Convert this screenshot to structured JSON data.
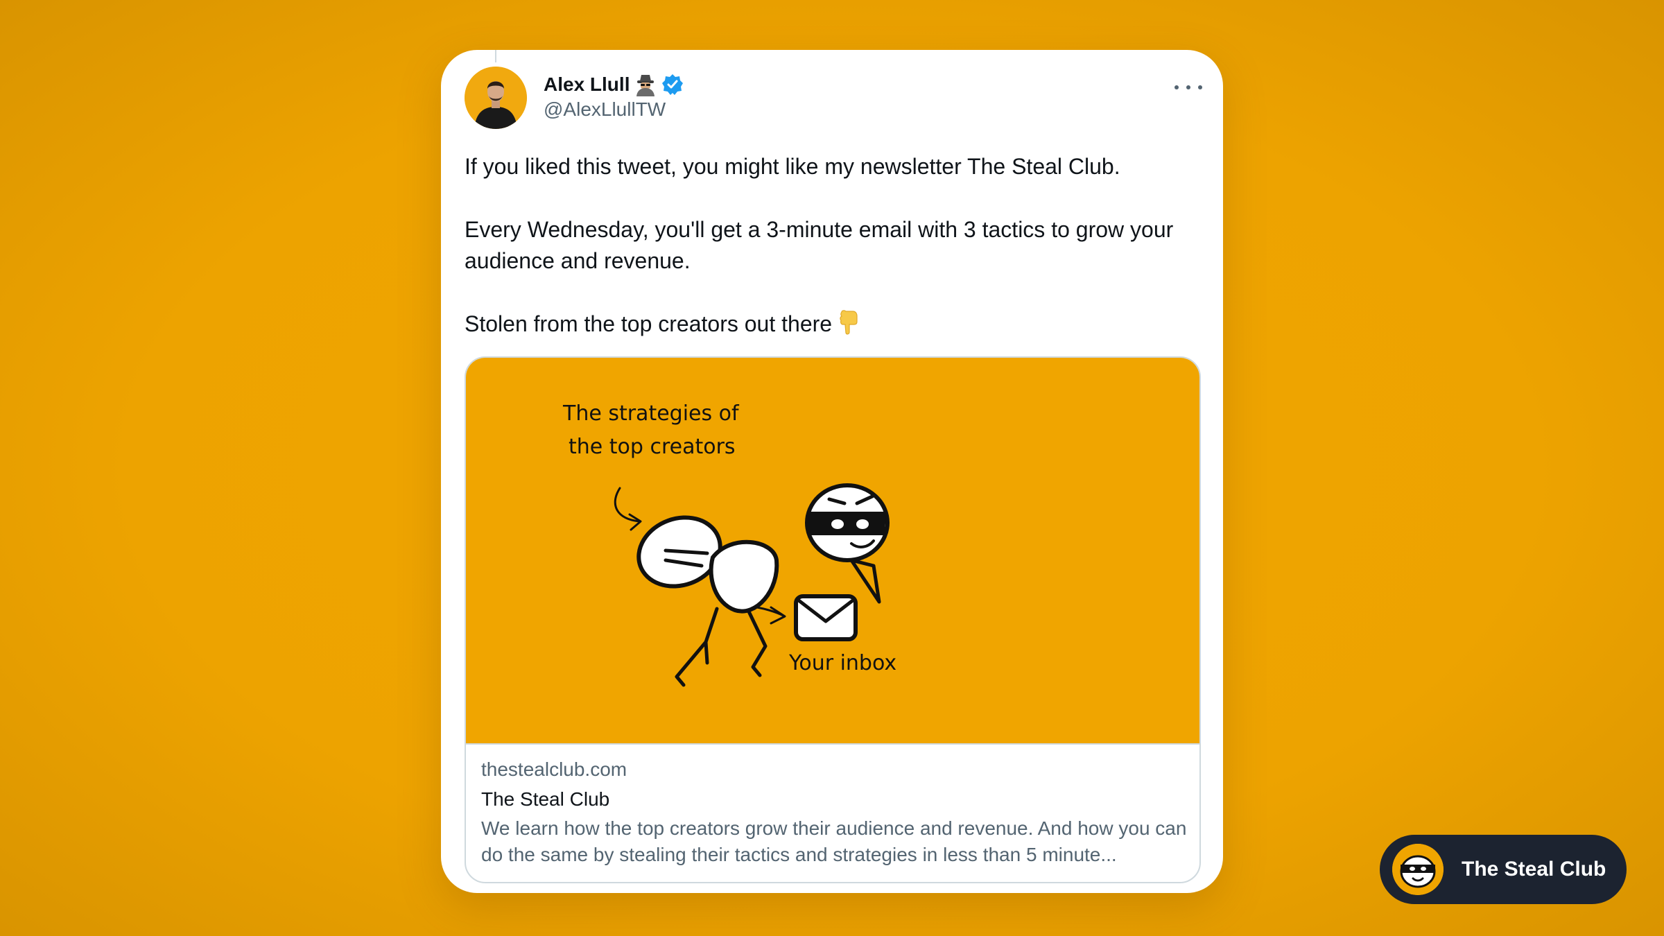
{
  "tweet": {
    "author_name": "Alex Llull",
    "author_handle": "@AlexLlullTW",
    "paragraphs": [
      "If you liked this tweet, you might like my newsletter The Steal Club.",
      "Every Wednesday, you'll get a 3-minute email with 3 tactics to grow your audience and revenue.",
      "Stolen from the top creators out there"
    ]
  },
  "link_card": {
    "image_caption_top": [
      "The strategies of",
      "the top creators"
    ],
    "image_caption_bottom": "Your inbox",
    "domain": "thestealclub.com",
    "title": "The Steal Club",
    "description": "We learn how the top creators grow their audience and revenue. And how you can do the same by stealing their tactics and strategies in less than 5 minute..."
  },
  "badge": {
    "label": "The Steal Club"
  },
  "colors": {
    "background": "#f0a500",
    "card": "#ffffff",
    "verified": "#1d9bf0",
    "badge": "#1c2330"
  },
  "icons": [
    "spy-emoji-icon",
    "verified-badge-icon",
    "more-options-icon",
    "pointing-down-emoji-icon",
    "envelope-icon",
    "thief-logo-icon"
  ]
}
